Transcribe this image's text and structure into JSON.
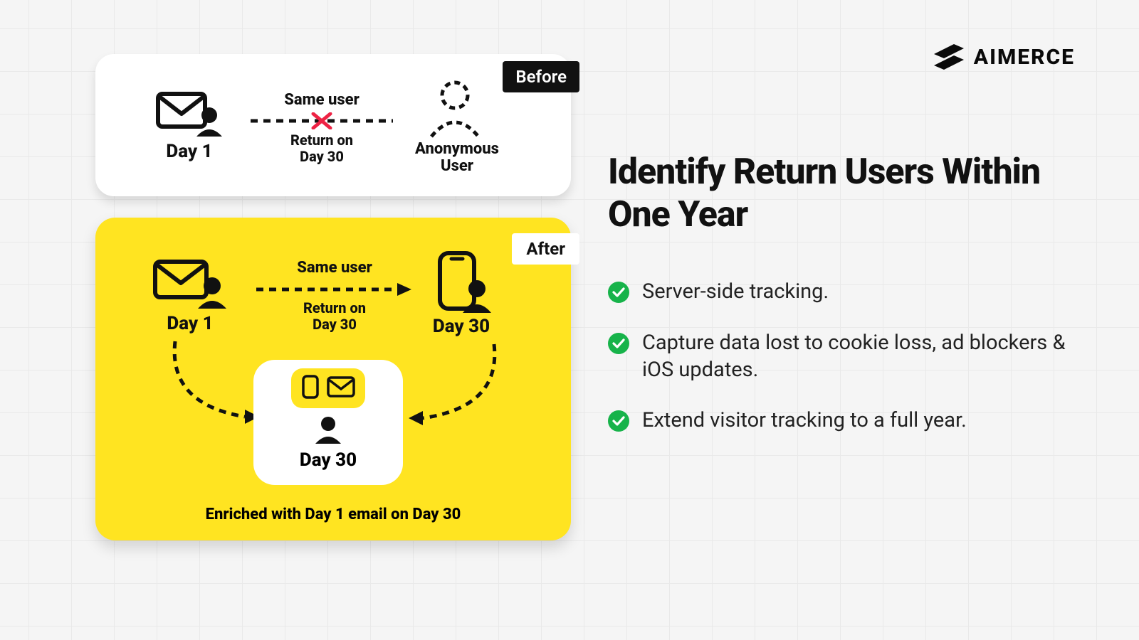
{
  "brand": {
    "name": "AIMERCE"
  },
  "headline": "Identify Return Users Within One Year",
  "bullets": [
    "Server-side tracking.",
    "Capture data lost to cookie loss, ad blockers & iOS updates.",
    "Extend visitor tracking to a full year."
  ],
  "before": {
    "badge": "Before",
    "left_label": "Day 1",
    "arrow_top": "Same user",
    "arrow_bottom_line1": "Return on",
    "arrow_bottom_line2": "Day 30",
    "right_label_line1": "Anonymous",
    "right_label_line2": "User"
  },
  "after": {
    "badge": "After",
    "left_label": "Day 1",
    "arrow_top": "Same user",
    "arrow_bottom_line1": "Return on",
    "arrow_bottom_line2": "Day 30",
    "right_label": "Day 30",
    "inner_label": "Day 30",
    "enriched": "Enriched with Day 1 email on Day 30"
  }
}
